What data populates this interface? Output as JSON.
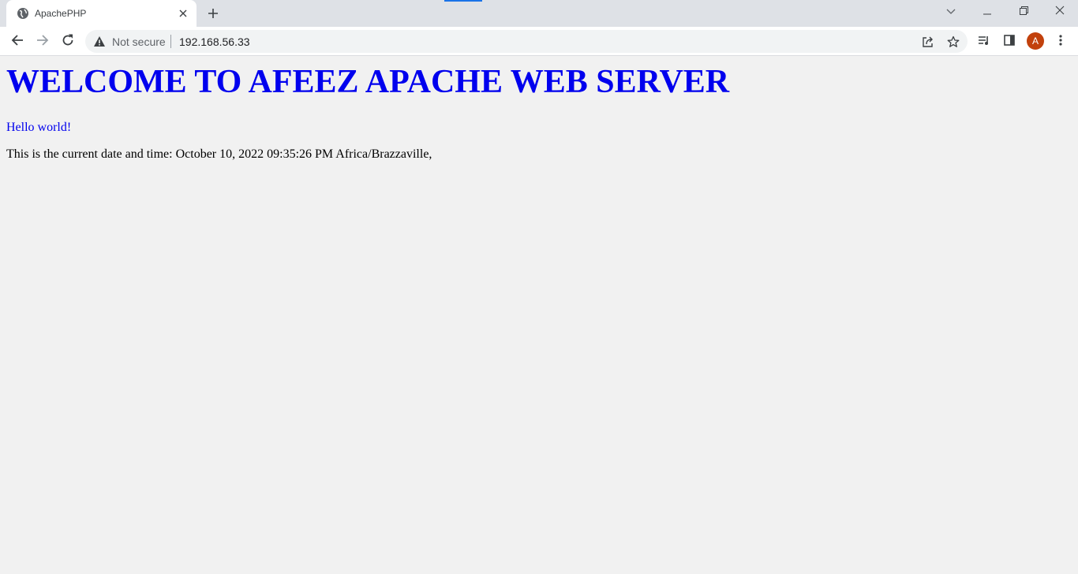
{
  "browser": {
    "tab": {
      "title": "ApachePHP",
      "favicon": "globe-icon"
    },
    "new_tab_icon": "plus-icon",
    "window_controls": [
      "chevron-down-icon",
      "minimize-icon",
      "restore-icon",
      "close-icon"
    ],
    "accent_color": "#1a73e8"
  },
  "toolbar": {
    "back_icon": "back-arrow-icon",
    "forward_icon": "forward-arrow-icon",
    "reload_icon": "reload-icon",
    "security_label": "Not secure",
    "url": "192.168.56.33",
    "share_icon": "share-icon",
    "bookmark_icon": "star-icon",
    "media_icon": "media-queue-icon",
    "side_panel_icon": "side-panel-icon",
    "avatar_letter": "A",
    "avatar_color": "#c2410c",
    "menu_icon": "kebab-menu-icon"
  },
  "page": {
    "heading": "WELCOME TO AFEEZ APACHE WEB SERVER",
    "hello": "Hello world!",
    "datetime": "This is the current date and time: October 10, 2022 09:35:26 PM Africa/Brazzaville,",
    "heading_color": "#0000ee",
    "background_color": "#f1f1f1"
  }
}
